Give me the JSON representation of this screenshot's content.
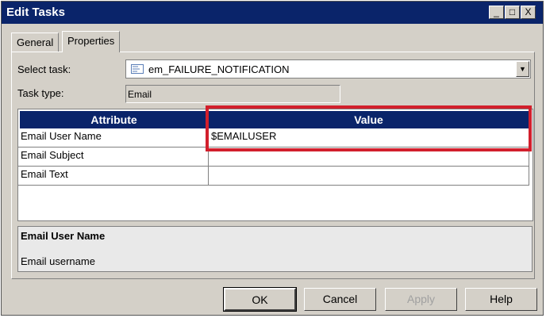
{
  "window": {
    "title": "Edit Tasks",
    "controls": {
      "minimize": "_",
      "maximize": "□",
      "close": "X"
    }
  },
  "tabs": [
    {
      "label": "General",
      "active": false
    },
    {
      "label": "Properties",
      "active": true
    }
  ],
  "form": {
    "select_task_label": "Select task:",
    "select_task_value": "em_FAILURE_NOTIFICATION",
    "task_type_label": "Task type:",
    "task_type_value": "Email"
  },
  "grid": {
    "headers": [
      "Attribute",
      "Value"
    ],
    "rows": [
      {
        "attribute": "Email User Name",
        "value": "$EMAILUSER"
      },
      {
        "attribute": "Email Subject",
        "value": ""
      },
      {
        "attribute": "Email Text",
        "value": ""
      }
    ],
    "highlight_color": "#d21f2c"
  },
  "description": {
    "title": "Email User Name",
    "text": "Email username"
  },
  "buttons": {
    "ok": "OK",
    "cancel": "Cancel",
    "apply": "Apply",
    "help": "Help"
  }
}
